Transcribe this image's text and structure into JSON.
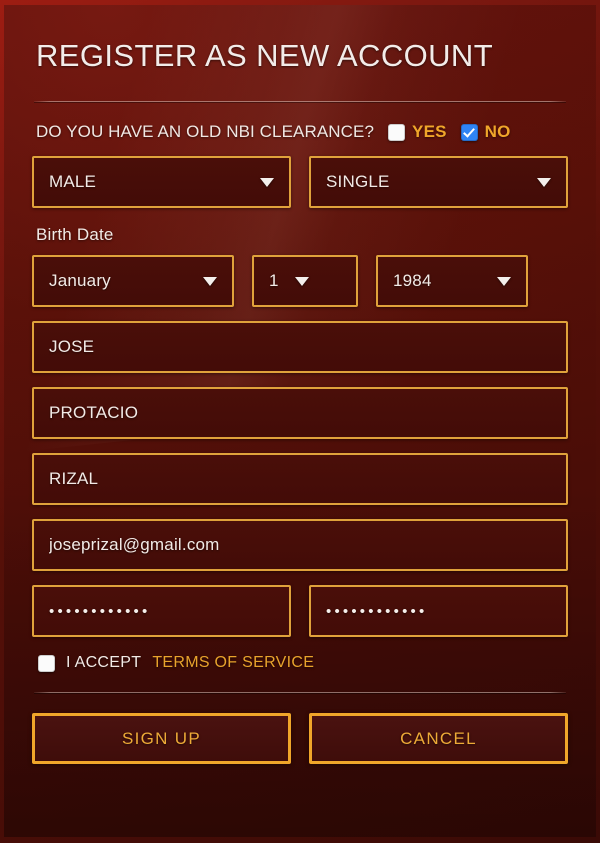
{
  "form": {
    "title": "REGISTER AS NEW ACCOUNT",
    "nbi": {
      "question": "DO YOU HAVE AN OLD NBI CLEARANCE?",
      "yes_label": "YES",
      "no_label": "NO",
      "yes_checked": false,
      "no_checked": true
    },
    "gender": {
      "value": "MALE"
    },
    "civil_status": {
      "value": "SINGLE"
    },
    "birth_date": {
      "label": "Birth Date",
      "month": "January",
      "day": "1",
      "year": "1984"
    },
    "first_name": {
      "value": "JOSE"
    },
    "middle_name": {
      "value": "PROTACIO"
    },
    "last_name": {
      "value": "RIZAL"
    },
    "email": {
      "value": "joseprizal@gmail.com"
    },
    "password": {
      "value": "••••••••••••"
    },
    "confirm_password": {
      "value": "••••••••••••"
    },
    "terms": {
      "accept_label": "I ACCEPT",
      "link_label": "TERMS OF SERVICE",
      "checked": false
    },
    "buttons": {
      "submit": "SIGN UP",
      "cancel": "CANCEL"
    }
  },
  "colors": {
    "gold": "#e0a23b",
    "gold_bright": "#f0a62a",
    "checkbox_blue": "#2f84f5",
    "panel_dark": "#4a0d07",
    "frame_red": "#9e1d12",
    "text_light": "#f2eae6"
  }
}
